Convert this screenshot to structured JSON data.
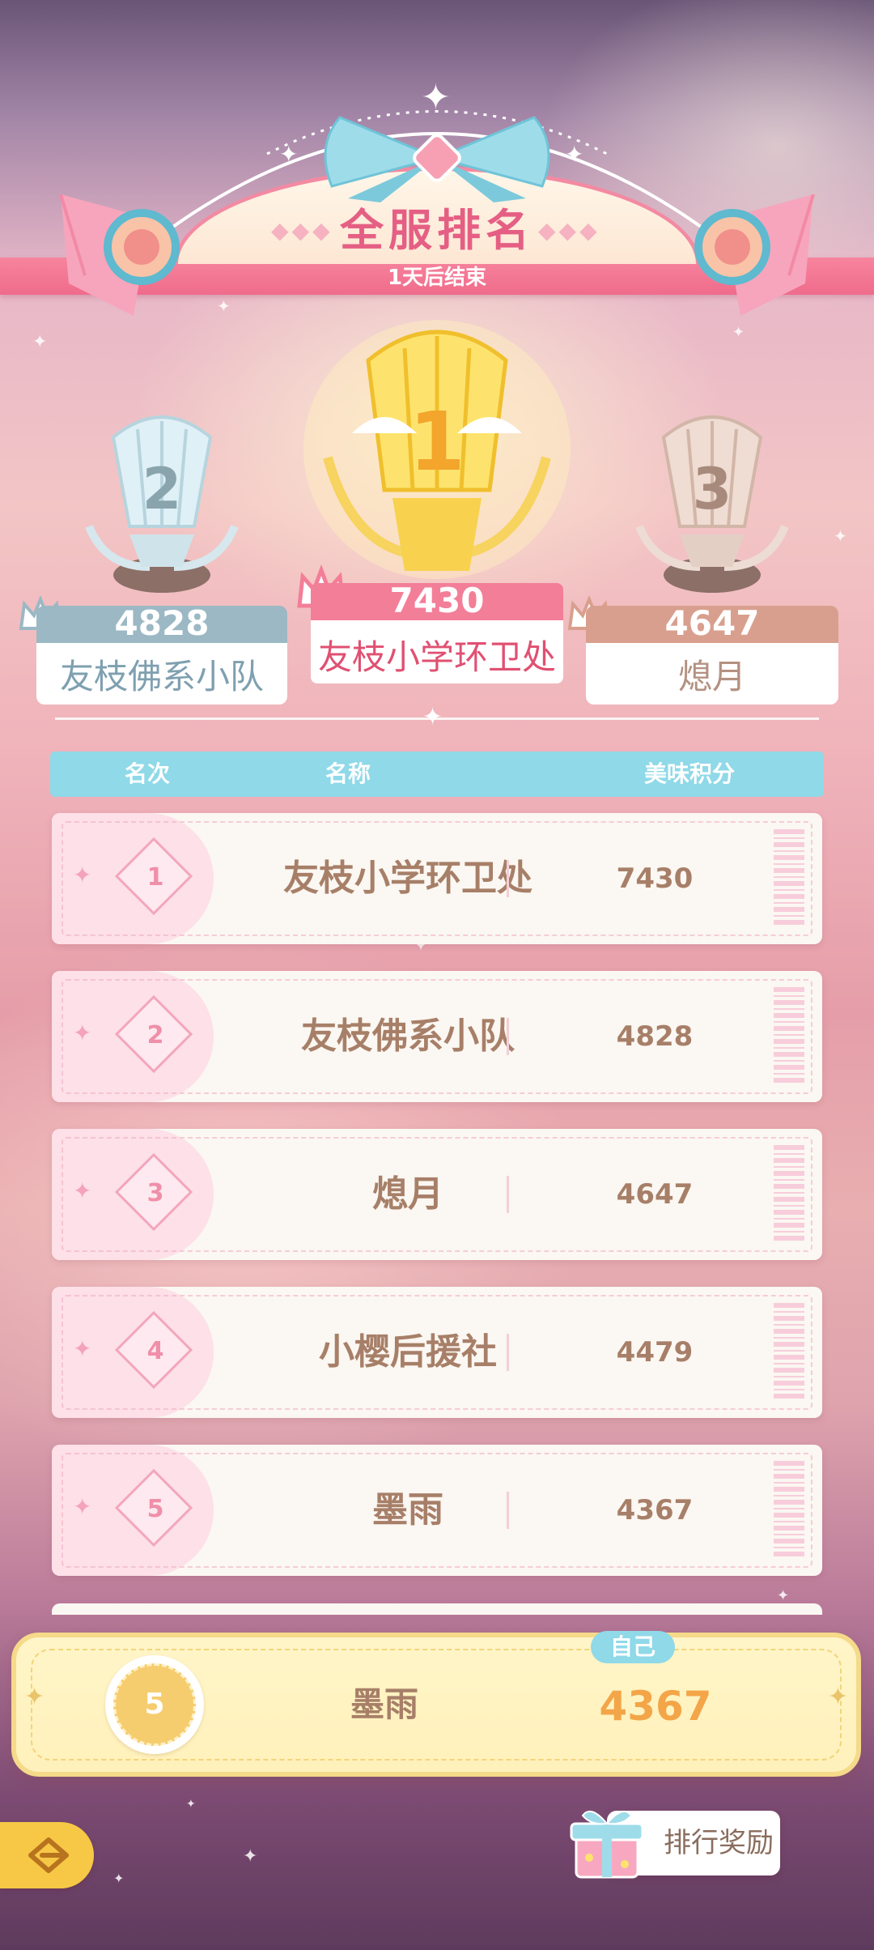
{
  "header": {
    "title": "全服排名",
    "subtitle": "1天后结束"
  },
  "podium": {
    "first": {
      "rank": "1",
      "score": "7430",
      "name": "友枝小学环卫处"
    },
    "second": {
      "rank": "2",
      "score": "4828",
      "name": "友枝佛系小队"
    },
    "third": {
      "rank": "3",
      "score": "4647",
      "name": "熄月"
    }
  },
  "table": {
    "columns": {
      "rank": "名次",
      "name": "名称",
      "score": "美味积分"
    },
    "rows": [
      {
        "rank": "1",
        "name": "友枝小学环卫处",
        "score": "7430"
      },
      {
        "rank": "2",
        "name": "友枝佛系小队",
        "score": "4828"
      },
      {
        "rank": "3",
        "name": "熄月",
        "score": "4647"
      },
      {
        "rank": "4",
        "name": "小樱后援社",
        "score": "4479"
      },
      {
        "rank": "5",
        "name": "墨雨",
        "score": "4367"
      }
    ]
  },
  "self": {
    "tag": "自己",
    "rank": "5",
    "name": "墨雨",
    "score": "4367"
  },
  "controls": {
    "reward_label": "排行奖励",
    "back_icon": "back-arrow-icon",
    "gift_icon": "gift-icon"
  },
  "colors": {
    "gold": "#f6cd6e",
    "silver": "#9bb8c4",
    "bronze": "#d99f8e",
    "pink": "#f37e98",
    "cyan": "#8fd9e8",
    "text_brown": "#a77f68",
    "self_score": "#f3a548"
  }
}
